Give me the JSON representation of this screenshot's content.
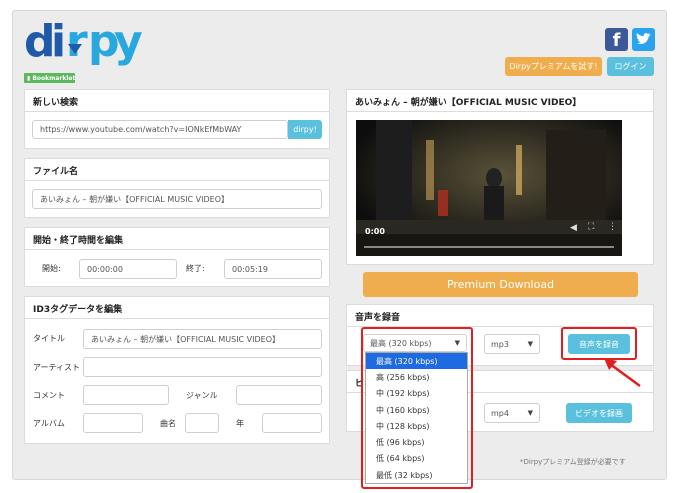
{
  "header": {
    "logo_text": "dirpy",
    "bookmarklet_label": "Bookmarklet",
    "premium_button": "Dirpyプレミアムを試す!",
    "login_button": "ログイン"
  },
  "search": {
    "heading": "新しい検索",
    "url_value": "https://www.youtube.com/watch?v=IONkEfMbWAY",
    "go_button": "dirpy!"
  },
  "filename": {
    "heading": "ファイル名",
    "value": "あいみょん – 朝が嫌い【OFFICIAL MUSIC VIDEO】"
  },
  "time": {
    "heading": "開始・終了時間を編集",
    "start_label": "開始:",
    "start_value": "00:00:00",
    "end_label": "終了:",
    "end_value": "00:05:19"
  },
  "id3": {
    "heading": "ID3タグデータを編集",
    "title_label": "タイトル",
    "title_value": "あいみょん – 朝が嫌い【OFFICIAL MUSIC VIDEO】",
    "artist_label": "アーティスト",
    "comment_label": "コメント",
    "genre_label": "ジャンル",
    "album_label": "アルバム",
    "track_label": "曲名",
    "year_label": "年"
  },
  "video": {
    "heading": "あいみょん – 朝が嫌い【OFFICIAL MUSIC VIDEO】",
    "time_current": "0:00"
  },
  "premium_download": "Premium Download",
  "audio": {
    "heading": "音声を録音",
    "quality_selected": "最高 (320 kbps)",
    "format_selected": "mp3",
    "record_button": "音声を録音",
    "options": [
      "最高 (320 kbps)",
      "高 (256 kbps)",
      "中 (192 kbps)",
      "中 (160 kbps)",
      "中 (128 kbps)",
      "低 (96 kbps)",
      "低 (64 kbps)",
      "最低 (32 kbps)"
    ]
  },
  "video_record": {
    "heading_partial": "ビ",
    "format_selected": "mp4",
    "record_button": "ビデオを録画"
  },
  "footnote": "*Dirpyプレミアム登録が必要です",
  "colors": {
    "accent_blue": "#5bc0de",
    "logo_blue": "#1f5aa8",
    "orange": "#f0ad4e",
    "highlight_red": "#e02020",
    "bookmarklet_green": "#5cb85c"
  }
}
